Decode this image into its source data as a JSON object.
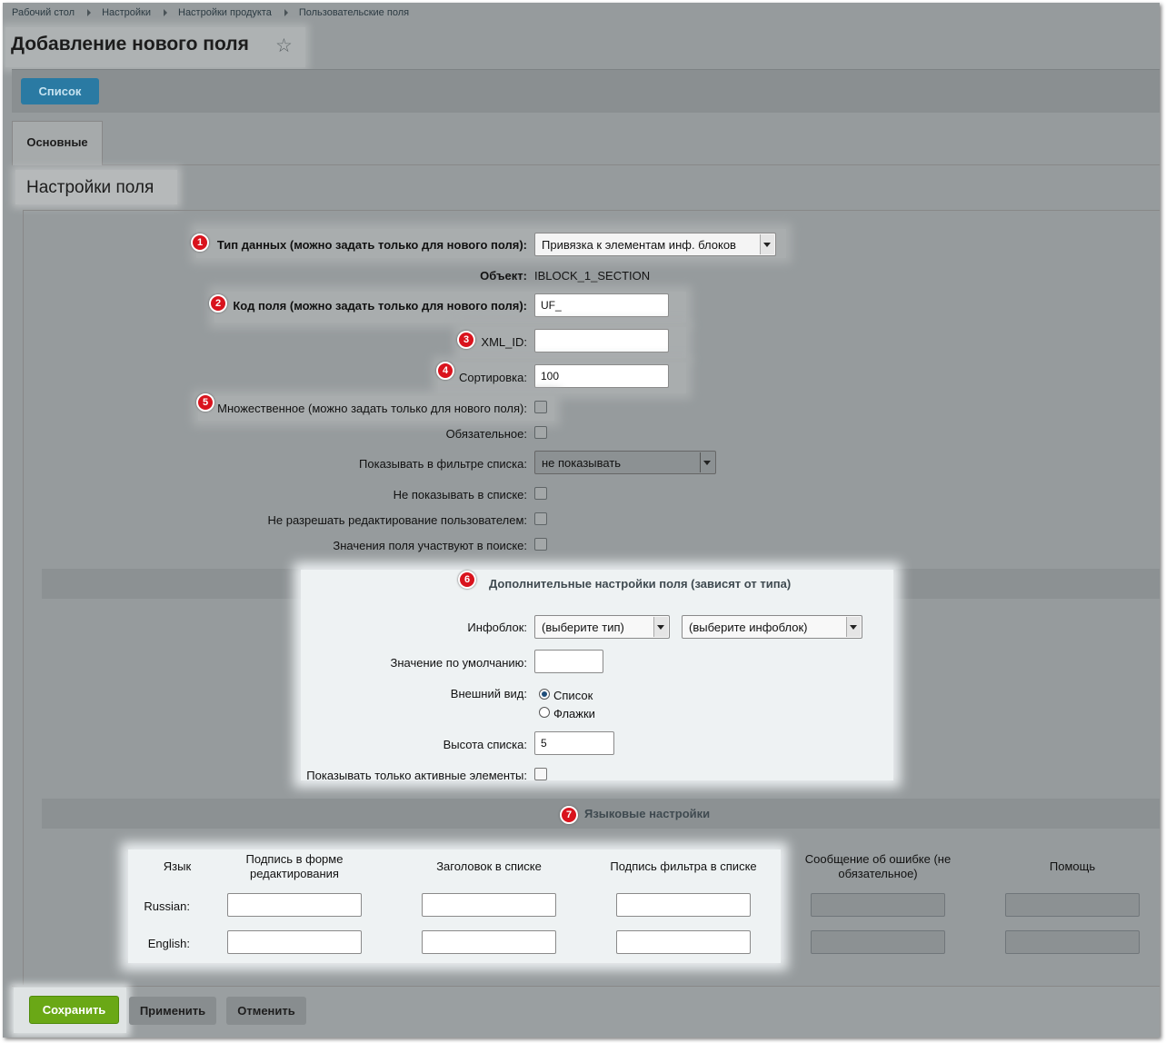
{
  "breadcrumb": [
    "Рабочий стол",
    "Настройки",
    "Настройки продукта",
    "Пользовательские поля"
  ],
  "page_title": "Добавление нового поля",
  "toolbar": {
    "list_button": "Список"
  },
  "tabs": [
    "Основные"
  ],
  "section_title": "Настройки поля",
  "fields": {
    "data_type": {
      "label": "Тип данных (можно задать только для нового поля):",
      "value": "Привязка к элементам инф. блоков",
      "badge": "1"
    },
    "object": {
      "label": "Объект:",
      "value": "IBLOCK_1_SECTION"
    },
    "field_code": {
      "label": "Код поля (можно задать только для нового поля):",
      "value": "UF_",
      "badge": "2"
    },
    "xml_id": {
      "label": "XML_ID:",
      "value": "",
      "badge": "3"
    },
    "sort": {
      "label": "Сортировка:",
      "value": "100",
      "badge": "4"
    },
    "multiple": {
      "label": "Множественное (можно задать только для нового поля):",
      "badge": "5"
    },
    "mandatory": {
      "label": "Обязательное:"
    },
    "show_filter": {
      "label": "Показывать в фильтре списка:",
      "value": "не показывать"
    },
    "hide_in_list": {
      "label": "Не показывать в списке:"
    },
    "no_edit": {
      "label": "Не разрешать редактирование пользователем:"
    },
    "searchable": {
      "label": "Значения поля участвуют в поиске:"
    }
  },
  "extra": {
    "title": "Дополнительные настройки поля (зависят от типа)",
    "badge": "6",
    "iblock_label": "Инфоблок:",
    "iblock_type": "(выберите тип)",
    "iblock": "(выберите инфоблок)",
    "default_label": "Значение по умолчанию:",
    "default_value": "",
    "view_label": "Внешний вид:",
    "view_options": [
      "Список",
      "Флажки"
    ],
    "height_label": "Высота списка:",
    "height_value": "5",
    "active_only_label": "Показывать только активные элементы:"
  },
  "lang": {
    "title": "Языковые настройки",
    "badge": "7",
    "headers": [
      "Язык",
      "Подпись в форме редактирования",
      "Заголовок в списке",
      "Подпись фильтра в списке",
      "Сообщение об ошибке (не обязательное)",
      "Помощь"
    ],
    "rows": [
      "Russian:",
      "English:"
    ]
  },
  "footer": {
    "save": "Сохранить",
    "apply": "Применить",
    "cancel": "Отменить"
  }
}
